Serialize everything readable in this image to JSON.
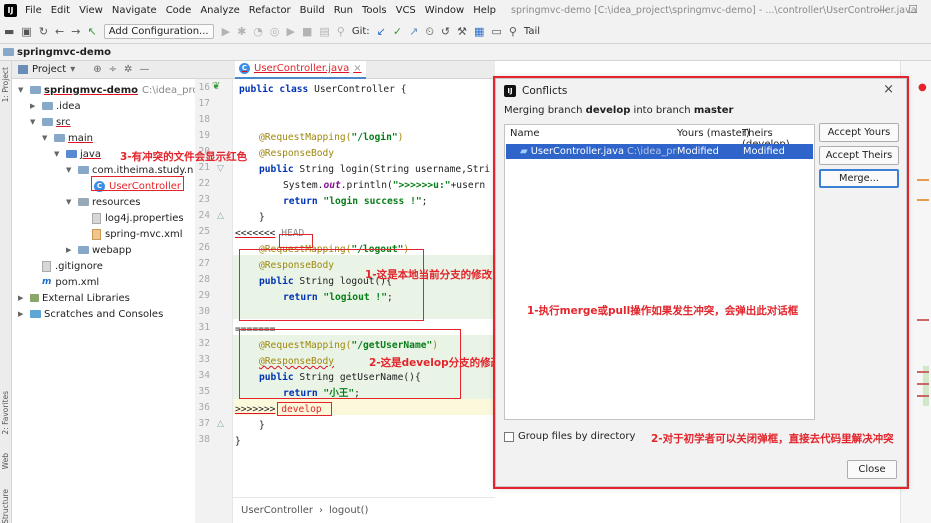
{
  "menubar": {
    "items": [
      "File",
      "Edit",
      "View",
      "Navigate",
      "Code",
      "Analyze",
      "Refactor",
      "Build",
      "Run",
      "Tools",
      "VCS",
      "Window",
      "Help"
    ],
    "window_title": "springmvc-demo [C:\\idea_project\\springmvc-demo] - ...\\controller\\UserController.java",
    "minimize": "—",
    "maximize": "☐"
  },
  "toolbar": {
    "add_config_label": "Add Configuration...",
    "git_label": "Git:",
    "tail_label": "Tail"
  },
  "navbar": {
    "project": "springmvc-demo"
  },
  "side_tools": {
    "project": "1: Project",
    "favorites": "2: Favorites",
    "web": "Web",
    "structure": "Structure"
  },
  "project_panel": {
    "title": "Project",
    "dropdown": "▾",
    "tree": {
      "root_name": "springmvc-demo",
      "root_path": "C:\\idea_project",
      "idea": ".idea",
      "src": "src",
      "main": "main",
      "java": "java",
      "package": "com.itheima.study.n",
      "controller": "UserController",
      "resources": "resources",
      "log4j": "log4j.properties",
      "springmvc": "spring-mvc.xml",
      "webapp": "webapp",
      "gitignore": ".gitignore",
      "pom": "pom.xml",
      "ext_libs": "External Libraries",
      "scratches": "Scratches and Consoles"
    }
  },
  "editor": {
    "tab_label": "UserController.java",
    "line_numbers": [
      "16",
      "17",
      "18",
      "19",
      "20",
      "21",
      "22",
      "23",
      "24",
      "25",
      "26",
      "27",
      "28",
      "29",
      "30",
      "31",
      "32",
      "33",
      "34",
      "35",
      "36",
      "37",
      "38"
    ],
    "code": {
      "l16_kw": "public class",
      "l16_rest": " UserController {",
      "l19_an": "@RequestMapping(",
      "l19_st": "\"/login\"",
      "l19_end": ")",
      "l20_an": "@ResponseBody",
      "l21_kw": "public",
      "l21_rest": " String login(String username,Stri",
      "l22_a": "System.",
      "l22_fi": "out",
      "l22_b": ".println(",
      "l22_st": "\">>>>>>u:\"",
      "l22_c": "+usern",
      "l23_kw": "return",
      "l23_st": " \"login success !\"",
      "l23_end": ";",
      "l24": "}",
      "l25_a": "<<<<<<<",
      "l25_b": " HEAD",
      "l26_an": "@RequestMapping(",
      "l26_st": "\"/logout\"",
      "l26_end": ")",
      "l27_an": "@ResponseBody",
      "l28_kw": "public",
      "l28_rest": " String logout(){",
      "l29_kw": "return",
      "l29_st": " \"logiout !\"",
      "l29_end": ";",
      "l30": "=======",
      "l31_an": "@RequestMapping(",
      "l31_st": "\"/getUserName\"",
      "l31_end": ")",
      "l32_an": "@ResponseBody",
      "l33_kw": "public",
      "l33_rest": " String getUserName(){",
      "l34_kw": "return",
      "l34_st": " \"小王\"",
      "l34_end": ";",
      "l35_a": ">>>>>>>",
      "l35_b": " develop",
      "l36": "}",
      "l37": "}"
    },
    "breadcrumb_class": "UserController",
    "breadcrumb_sep": "›",
    "breadcrumb_method": "logout()"
  },
  "annotations": {
    "red_file": "3-有冲突的文件会显示红色",
    "local_change": "1-这是本地当前分支的修改",
    "develop_change": "2-这是develop分支的修改",
    "dialog_popup": "1-执行merge或pull操作如果发生冲突，会弹出此对话框",
    "beginner_tip": "2-对于初学者可以关闭弹框，直接去代码里解决冲突"
  },
  "dialog": {
    "title": "Conflicts",
    "close_x": "×",
    "subtitle_pre": "Merging branch ",
    "subtitle_b1": "develop",
    "subtitle_mid": " into branch ",
    "subtitle_b2": "master",
    "columns": [
      "Name",
      "Yours (master)",
      "Theirs (develop)"
    ],
    "row": {
      "file": "UserController.java",
      "path": "C:\\idea_proje",
      "yours": "Modified",
      "theirs": "Modified"
    },
    "accept_yours": "Accept Yours",
    "accept_theirs": "Accept Theirs",
    "merge": "Merge...",
    "group_files": "Group files by directory",
    "close": "Close"
  },
  "colors": {
    "annotation_red": "#e3242b",
    "selection_blue": "#2f65ca",
    "focus_blue": "#3d7fd4"
  }
}
